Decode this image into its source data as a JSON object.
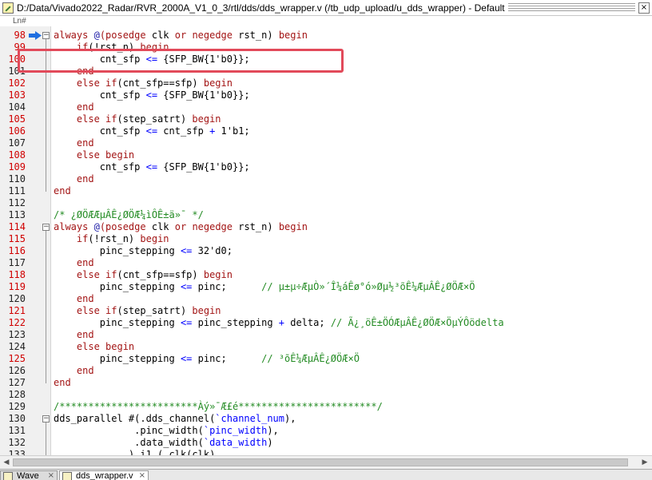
{
  "window": {
    "title": "D:/Data/Vivado2022_Radar/RVR_2000A_V1_0_3/rtl/dds/dds_wrapper.v (/tb_udp_upload/u_dds_wrapper) - Default",
    "close_glyph": "×"
  },
  "ruler": {
    "label": "Ln#"
  },
  "tabs": [
    {
      "label": "Wave",
      "close": "×"
    },
    {
      "label": "dds_wrapper.v",
      "close": "×"
    }
  ],
  "code_lines": [
    {
      "n": "98",
      "red": true,
      "fold": "minus",
      "current": true,
      "segs": [
        [
          "kw",
          "always "
        ],
        [
          "sy",
          "@"
        ],
        [
          "kw",
          "(posedge "
        ],
        [
          "",
          "clk "
        ],
        [
          "kw",
          "or "
        ],
        [
          "kw",
          "negedge "
        ],
        [
          "",
          "rst_n) "
        ],
        [
          "kw",
          "begin"
        ]
      ]
    },
    {
      "n": "99",
      "red": true,
      "segs": [
        [
          "",
          "    "
        ],
        [
          "kw",
          "if"
        ],
        [
          "",
          "(!rst_n) "
        ],
        [
          "kw",
          "begin"
        ]
      ]
    },
    {
      "n": "100",
      "red": true,
      "segs": [
        [
          "",
          "        cnt_sfp "
        ],
        [
          "op",
          "<="
        ],
        [
          "",
          " {SFP_BW{1'b0}};"
        ]
      ]
    },
    {
      "n": "101",
      "red": false,
      "segs": [
        [
          "",
          "    "
        ],
        [
          "kw",
          "end"
        ]
      ]
    },
    {
      "n": "102",
      "red": true,
      "segs": [
        [
          "",
          "    "
        ],
        [
          "kw",
          "else if"
        ],
        [
          "",
          "(cnt_sfp==sfp) "
        ],
        [
          "kw",
          "begin"
        ]
      ]
    },
    {
      "n": "103",
      "red": true,
      "segs": [
        [
          "",
          "        cnt_sfp "
        ],
        [
          "op",
          "<="
        ],
        [
          "",
          " {SFP_BW{1'b0}};"
        ]
      ]
    },
    {
      "n": "104",
      "red": false,
      "segs": [
        [
          "",
          "    "
        ],
        [
          "kw",
          "end"
        ]
      ]
    },
    {
      "n": "105",
      "red": true,
      "segs": [
        [
          "",
          "    "
        ],
        [
          "kw",
          "else if"
        ],
        [
          "",
          "(step_satrt) "
        ],
        [
          "kw",
          "begin"
        ]
      ]
    },
    {
      "n": "106",
      "red": true,
      "segs": [
        [
          "",
          "        cnt_sfp "
        ],
        [
          "op",
          "<="
        ],
        [
          "",
          " cnt_sfp "
        ],
        [
          "op",
          "+"
        ],
        [
          "",
          " 1'b1;"
        ]
      ]
    },
    {
      "n": "107",
      "red": false,
      "segs": [
        [
          "",
          "    "
        ],
        [
          "kw",
          "end"
        ]
      ]
    },
    {
      "n": "108",
      "red": true,
      "segs": [
        [
          "",
          "    "
        ],
        [
          "kw",
          "else begin"
        ]
      ]
    },
    {
      "n": "109",
      "red": true,
      "segs": [
        [
          "",
          "        cnt_sfp "
        ],
        [
          "op",
          "<="
        ],
        [
          "",
          " {SFP_BW{1'b0}};"
        ]
      ]
    },
    {
      "n": "110",
      "red": false,
      "segs": [
        [
          "",
          "    "
        ],
        [
          "kw",
          "end"
        ]
      ]
    },
    {
      "n": "111",
      "red": false,
      "segs": [
        [
          "kw",
          "end"
        ]
      ]
    },
    {
      "n": "112",
      "red": false,
      "segs": []
    },
    {
      "n": "113",
      "red": false,
      "segs": [
        [
          "cm",
          "/* ¿ØÖÆÆµÂÊ¿ØÖÆ¼ìÔÊ±ä»¯ */"
        ]
      ]
    },
    {
      "n": "114",
      "red": true,
      "fold": "minus",
      "segs": [
        [
          "kw",
          "always "
        ],
        [
          "sy",
          "@"
        ],
        [
          "kw",
          "(posedge "
        ],
        [
          "",
          "clk "
        ],
        [
          "kw",
          "or "
        ],
        [
          "kw",
          "negedge "
        ],
        [
          "",
          "rst_n) "
        ],
        [
          "kw",
          "begin"
        ]
      ]
    },
    {
      "n": "115",
      "red": true,
      "segs": [
        [
          "",
          "    "
        ],
        [
          "kw",
          "if"
        ],
        [
          "",
          "(!rst_n) "
        ],
        [
          "kw",
          "begin"
        ]
      ]
    },
    {
      "n": "116",
      "red": true,
      "segs": [
        [
          "",
          "        pinc_stepping "
        ],
        [
          "op",
          "<="
        ],
        [
          "",
          " 32'd0;"
        ]
      ]
    },
    {
      "n": "117",
      "red": false,
      "segs": [
        [
          "",
          "    "
        ],
        [
          "kw",
          "end"
        ]
      ]
    },
    {
      "n": "118",
      "red": true,
      "segs": [
        [
          "",
          "    "
        ],
        [
          "kw",
          "else if"
        ],
        [
          "",
          "(cnt_sfp==sfp) "
        ],
        [
          "kw",
          "begin"
        ]
      ]
    },
    {
      "n": "119",
      "red": true,
      "segs": [
        [
          "",
          "        pinc_stepping "
        ],
        [
          "op",
          "<="
        ],
        [
          "",
          " pinc;      "
        ],
        [
          "cm",
          "// µ±µ÷ÆµÒ»´Î¼áÊø°ó»Øµ½³õÊ¼ÆµÂÊ¿ØÖÆ×Ö"
        ]
      ]
    },
    {
      "n": "120",
      "red": false,
      "segs": [
        [
          "",
          "    "
        ],
        [
          "kw",
          "end"
        ]
      ]
    },
    {
      "n": "121",
      "red": true,
      "segs": [
        [
          "",
          "    "
        ],
        [
          "kw",
          "else if"
        ],
        [
          "",
          "(step_satrt) "
        ],
        [
          "kw",
          "begin"
        ]
      ]
    },
    {
      "n": "122",
      "red": true,
      "segs": [
        [
          "",
          "        pinc_stepping "
        ],
        [
          "op",
          "<="
        ],
        [
          "",
          " pinc_stepping "
        ],
        [
          "op",
          "+"
        ],
        [
          "",
          " delta; "
        ],
        [
          "cm",
          "// Ã¿¸öÊ±ÖÓÆµÂÊ¿ØÖÆ×ÖµÝÔödelta"
        ]
      ]
    },
    {
      "n": "123",
      "red": false,
      "segs": [
        [
          "",
          "    "
        ],
        [
          "kw",
          "end"
        ]
      ]
    },
    {
      "n": "124",
      "red": false,
      "segs": [
        [
          "",
          "    "
        ],
        [
          "kw",
          "else begin"
        ]
      ]
    },
    {
      "n": "125",
      "red": true,
      "segs": [
        [
          "",
          "        pinc_stepping "
        ],
        [
          "op",
          "<="
        ],
        [
          "",
          " pinc;      "
        ],
        [
          "cm",
          "// ³õÊ¼ÆµÂÊ¿ØÖÆ×Ö"
        ]
      ]
    },
    {
      "n": "126",
      "red": false,
      "segs": [
        [
          "",
          "    "
        ],
        [
          "kw",
          "end"
        ]
      ]
    },
    {
      "n": "127",
      "red": false,
      "segs": [
        [
          "kw",
          "end"
        ]
      ]
    },
    {
      "n": "128",
      "red": false,
      "segs": []
    },
    {
      "n": "129",
      "red": false,
      "segs": [
        [
          "cm",
          "/************************Àý»¯Æ£é************************/"
        ]
      ]
    },
    {
      "n": "130",
      "red": false,
      "fold": "minus",
      "segs": [
        [
          "",
          "dds_parallel #(.dds_channel("
        ],
        [
          "op",
          "`channel_num"
        ],
        [
          "",
          "),"
        ]
      ]
    },
    {
      "n": "131",
      "red": false,
      "segs": [
        [
          "",
          "              .pinc_width("
        ],
        [
          "op",
          "`pinc_width"
        ],
        [
          "",
          "),"
        ]
      ]
    },
    {
      "n": "132",
      "red": false,
      "segs": [
        [
          "",
          "              .data_width("
        ],
        [
          "op",
          "`data_width"
        ],
        [
          "",
          ")"
        ]
      ]
    },
    {
      "n": "133",
      "red": false,
      "segs": [
        [
          "",
          "             ) i1 (.clk(clk),"
        ]
      ]
    }
  ]
}
